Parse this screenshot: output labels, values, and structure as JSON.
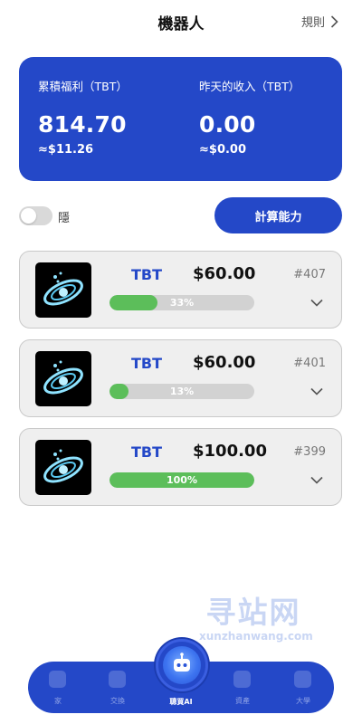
{
  "header": {
    "title": "機器人",
    "rules_label": "規則"
  },
  "summary": {
    "total_label": "累積福利（TBT）",
    "total_value": "814.70",
    "total_usd": "≈$11.26",
    "yesterday_label": "昨天的收入（TBT）",
    "yesterday_value": "0.00",
    "yesterday_usd": "≈$0.00"
  },
  "controls": {
    "hide_toggle_on": false,
    "hide_label": "隱",
    "compute_button": "計算能力"
  },
  "robots": [
    {
      "token": "TBT",
      "amount": "$60.00",
      "id": "#407",
      "progress": 0.33,
      "progress_label": "33%"
    },
    {
      "token": "TBT",
      "amount": "$60.00",
      "id": "#401",
      "progress": 0.13,
      "progress_label": "13%"
    },
    {
      "token": "TBT",
      "amount": "$100.00",
      "id": "#399",
      "progress": 1.0,
      "progress_label": "100%"
    }
  ],
  "watermark": {
    "big": "寻站网",
    "small": "xunzhanwang.com"
  },
  "nav": {
    "items": [
      {
        "label": "家",
        "icon": "home-icon"
      },
      {
        "label": "交換",
        "icon": "exchange-icon"
      },
      {
        "label": "聰買AI",
        "icon": "robot-icon"
      },
      {
        "label": "資產",
        "icon": "wallet-icon"
      },
      {
        "label": "大學",
        "icon": "chat-icon"
      }
    ],
    "active_index": 2
  },
  "colors": {
    "primary": "#2448c8",
    "progress_fill": "#5cbe5a",
    "progress_track": "#d2d2d2",
    "card_bg": "#efefef"
  }
}
